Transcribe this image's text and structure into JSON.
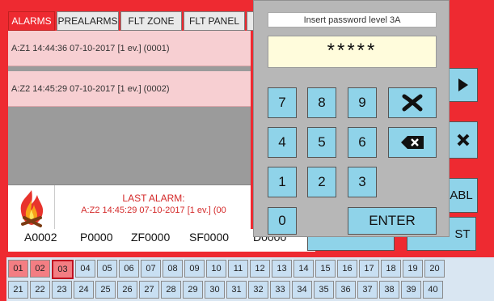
{
  "tabs": [
    {
      "label": "ALARMS",
      "active": true
    },
    {
      "label": "PREALARMS",
      "active": false
    },
    {
      "label": "FLT ZONE",
      "active": false
    },
    {
      "label": "FLT PANEL",
      "active": false
    }
  ],
  "alarm_rows": [
    "A:Z1 14:44:36 07-10-2017 [1 ev.] (0001)",
    "A:Z2 14:45:29 07-10-2017 [1 ev.] (0002)"
  ],
  "last_alarm": {
    "title": "LAST ALARM:",
    "text": "A:Z2 14:45:29 07-10-2017 [1 ev.] (00"
  },
  "counters": {
    "alarms": "A0002",
    "prealarms": "P0000",
    "faults_zone": "ZF0000",
    "faults_system": "SF0000",
    "disabled": "D0000"
  },
  "right_buttons": {
    "enable_label": "ABL",
    "test_label": "ST"
  },
  "password_dialog": {
    "title": "Insert password level 3A",
    "masked_value": "*****",
    "keys": [
      "7",
      "8",
      "9",
      "4",
      "5",
      "6",
      "1",
      "2",
      "3",
      "0"
    ],
    "enter_label": "ENTER"
  },
  "zones_row1": [
    "01",
    "02",
    "03",
    "04",
    "05",
    "06",
    "07",
    "08",
    "09",
    "10",
    "11",
    "12",
    "13",
    "14",
    "15",
    "16",
    "17",
    "18",
    "19",
    "20"
  ],
  "zones_row2": [
    "21",
    "22",
    "23",
    "24",
    "25",
    "26",
    "27",
    "28",
    "29",
    "30",
    "31",
    "32",
    "33",
    "34",
    "35",
    "36",
    "37",
    "38",
    "39",
    "40"
  ],
  "zones_in_alarm": [
    "01",
    "02",
    "03"
  ],
  "selected_zone": "03",
  "colors": {
    "brand_red": "#ee2a31",
    "alarm_row_bg": "#f7cfd2",
    "key_blue": "#8fd3e9",
    "zone_blue": "#c8dff2",
    "zone_alarm": "#f37e83",
    "dialog_gray": "#b7b7b7"
  }
}
